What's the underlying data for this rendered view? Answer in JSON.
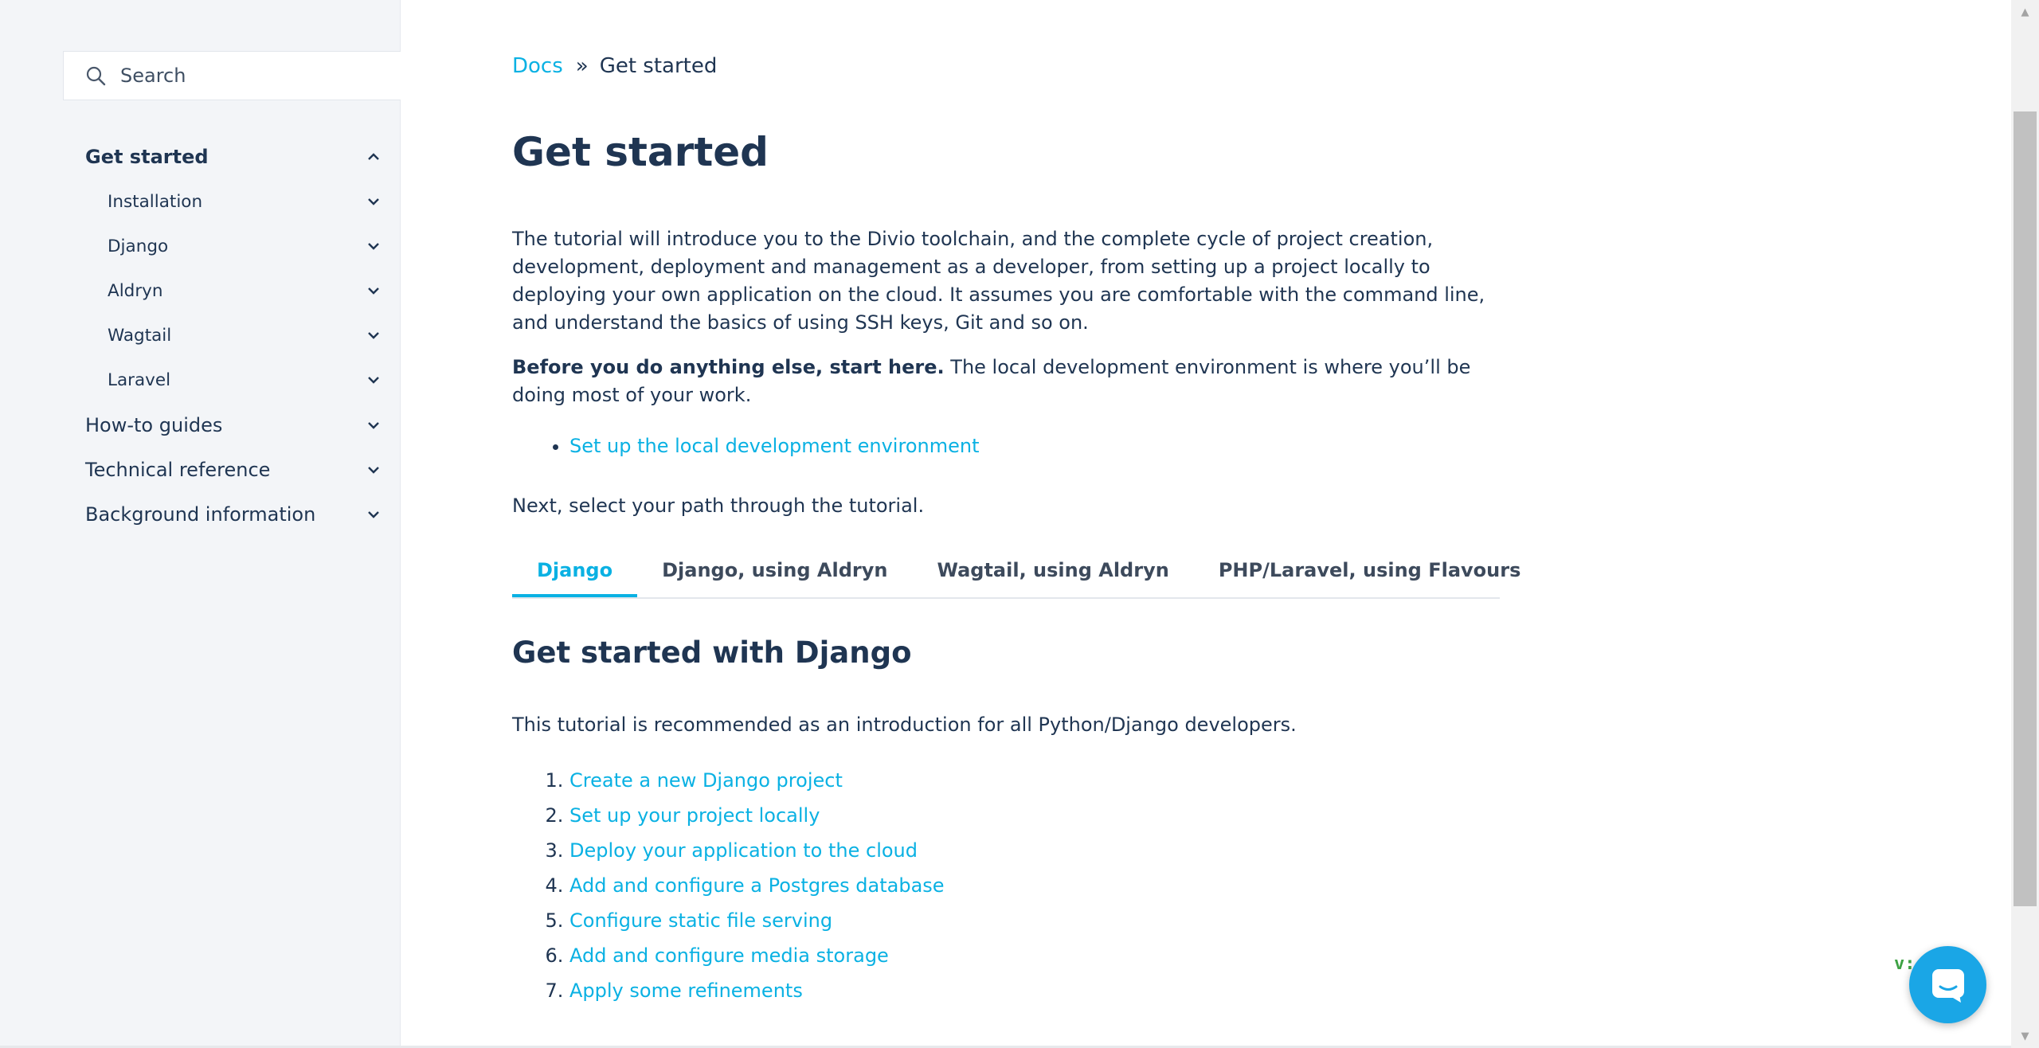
{
  "search": {
    "placeholder": "Search",
    "icon": "search-icon"
  },
  "sidebar": {
    "items": [
      {
        "label": "Get started",
        "chevron": "chevron-up-icon"
      },
      {
        "label": "Installation",
        "chevron": "chevron-down-icon"
      },
      {
        "label": "Django",
        "chevron": "chevron-down-icon"
      },
      {
        "label": "Aldryn",
        "chevron": "chevron-down-icon"
      },
      {
        "label": "Wagtail",
        "chevron": "chevron-down-icon"
      },
      {
        "label": "Laravel",
        "chevron": "chevron-down-icon"
      },
      {
        "label": "How-to guides",
        "chevron": "chevron-down-icon"
      },
      {
        "label": "Technical reference",
        "chevron": "chevron-down-icon"
      },
      {
        "label": "Background information",
        "chevron": "chevron-down-icon"
      }
    ]
  },
  "breadcrumb": {
    "root": "Docs",
    "separator": "»",
    "current": "Get started"
  },
  "page": {
    "title": "Get started",
    "intro": "The tutorial will introduce you to the Divio toolchain, and the complete cycle of project creation, development, deployment and management as a developer, from setting up a project locally to deploying your own application on the cloud. It assumes you are comfortable with the command line, and understand the basics of using SSH keys, Git and so on.",
    "before_bold": "Before you do anything else, start here.",
    "before_rest": " The local development environment is where you’ll be doing most of your work.",
    "setup_link": "Set up the local development environment",
    "next_text": "Next, select your path through the tutorial."
  },
  "tabs": [
    {
      "label": "Django",
      "active": true
    },
    {
      "label": "Django, using Aldryn",
      "active": false
    },
    {
      "label": "Wagtail, using Aldryn",
      "active": false
    },
    {
      "label": "PHP/Laravel, using Flavours",
      "active": false
    }
  ],
  "section": {
    "title": "Get started with Django",
    "desc": "This tutorial is recommended as an introduction for all Python/Django developers.",
    "steps": [
      "Create a new Django project",
      "Set up your project locally",
      "Deploy your application to the cloud",
      "Add and configure a Postgres database",
      "Configure static file serving",
      "Add and configure media storage",
      "Apply some refinements"
    ]
  },
  "version_badge": "v:",
  "colors": {
    "accent": "#0ab1e3",
    "text": "#1f3552",
    "chat": "#1aa6e6",
    "version": "#3ea244"
  }
}
